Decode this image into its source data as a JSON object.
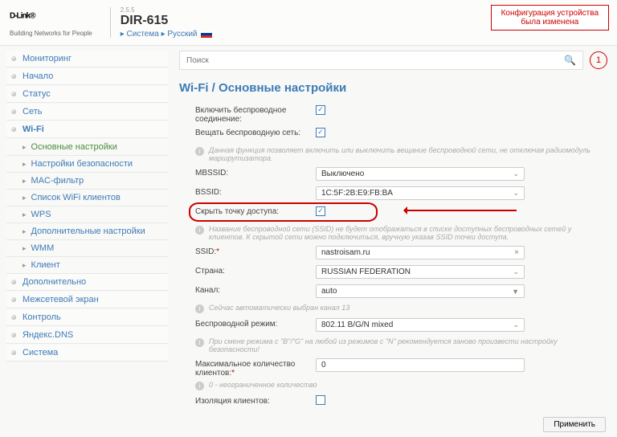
{
  "header": {
    "logo_main": "D-Link",
    "logo_sub": "Building Networks for People",
    "version": "2.5.5",
    "model": "DIR-615",
    "bc_system": "Система",
    "bc_lang": "Русский",
    "alert_l1": "Конфигурация устройства",
    "alert_l2": "была изменена"
  },
  "search": {
    "placeholder": "Поиск",
    "counter": "1"
  },
  "nav": {
    "monitoring": "Мониторинг",
    "start": "Начало",
    "status": "Статус",
    "network": "Сеть",
    "wifi": "Wi-Fi",
    "sub_basic": "Основные настройки",
    "sub_security": "Настройки безопасности",
    "sub_mac": "MAC-фильтр",
    "sub_clients": "Список WiFi клиентов",
    "sub_wps": "WPS",
    "sub_advanced": "Дополнительные настройки",
    "sub_wmm": "WMM",
    "sub_client": "Клиент",
    "advanced": "Дополнительно",
    "firewall": "Межсетевой экран",
    "control": "Контроль",
    "yandex": "Яндекс.DNS",
    "system": "Система"
  },
  "page": {
    "title": "Wi-Fi /  Основные настройки",
    "enable_wireless": "Включить беспроводное соединение:",
    "broadcast": "Вещать беспроводную сеть:",
    "broadcast_hint": "Данная функция позволяет включить или выключить вещание беспроводной сети, не отключая радиомодуль маршрутизатора.",
    "mbssid": "MBSSID:",
    "mbssid_val": "Выключено",
    "bssid": "BSSID:",
    "bssid_val": "1C:5F:2B:E9:FB:BA",
    "hide_ap": "Скрыть точку доступа:",
    "hide_ap_hint": "Название беспроводной сети (SSID) не будет отображаться в списке доступных беспроводных сетей у клиентов. К скрытой сети можно подключиться, вручную указав SSID точки доступа.",
    "ssid": "SSID:",
    "ssid_val": "nastroisam.ru",
    "country": "Страна:",
    "country_val": "RUSSIAN FEDERATION",
    "channel": "Канал:",
    "channel_val": "auto",
    "channel_hint": "Сейчас автоматически выбран канал 13",
    "mode": "Беспроводной режим:",
    "mode_val": "802.11 B/G/N mixed",
    "mode_hint": "При смене режима с \"B\"/\"G\" на любой из режимов с \"N\" рекомендуется заново произвести настройку безопасности!",
    "max_clients": "Максимальное количество клиентов:",
    "max_clients_val": "0",
    "max_clients_hint": "0 - неограниченное количество",
    "isolation": "Изоляция клиентов:",
    "apply": "Применить"
  }
}
